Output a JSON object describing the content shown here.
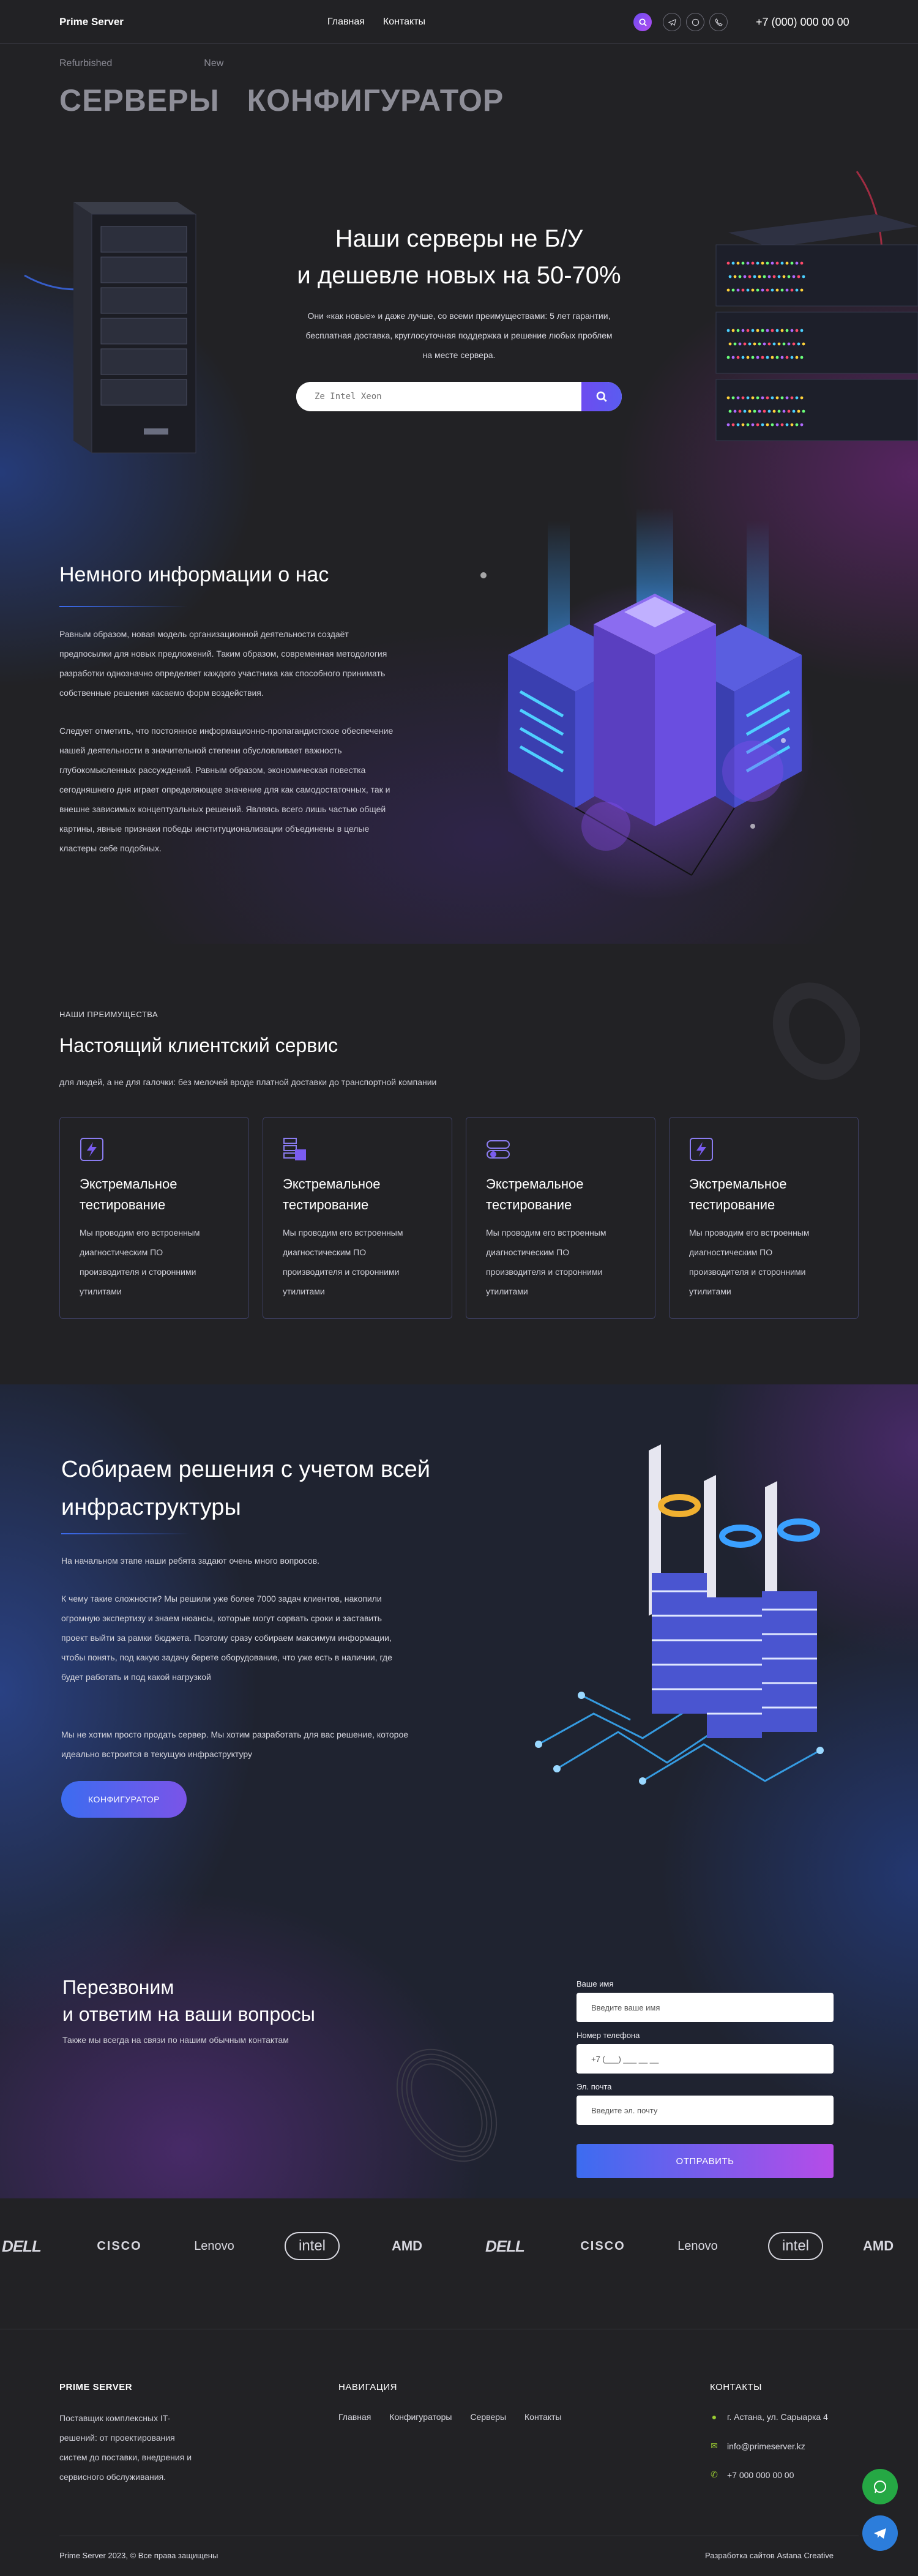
{
  "header": {
    "logo": "Prime Server",
    "nav": [
      "Главная",
      "Контакты"
    ],
    "phone": "+7 (000) 000 00 00"
  },
  "hero": {
    "tabs_small": [
      "Refurbished",
      "New"
    ],
    "tabs_big": [
      "СЕРВЕРЫ",
      "КОНФИГУРАТОР"
    ],
    "title_line1": "Наши серверы не Б/У",
    "title_line2": "и дешевле новых на 50-70%",
    "subtitle": "Они «как новые» и даже лучше, со всеми преимуществами: 5 лет гарантии, бесплатная доставка, круглосуточная поддержка и решение любых проблем на месте сервера.",
    "search_placeholder": "Ze Intel Xeon"
  },
  "about": {
    "title": "Немного информации о нас",
    "p1": "Равным образом, новая модель организационной деятельности создаёт предпосылки для новых предложений. Таким образом, современная методология разработки однозначно определяет каждого участника как способного принимать собственные решения касаемо форм воздействия.",
    "p2": "Следует отметить, что постоянное информационно-пропагандистское обеспечение нашей деятельности в значительной степени обусловливает важность глубокомысленных рассуждений. Равным образом, экономическая повестка сегодняшнего дня играет определяющее значение для как самодостаточных, так и внешне зависимых концептуальных решений. Являясь всего лишь частью общей картины, явные признаки победы институционализации объединены в целые кластеры себе подобных."
  },
  "advantages": {
    "label": "НАШИ ПРЕИМУЩЕСТВА",
    "title": "Настоящий клиентский сервис",
    "subtitle": "для людей, а не для галочки: без мелочей вроде платной доставки до транспортной компании",
    "cards": [
      {
        "title": "Экстремальное тестирование",
        "text": "Мы проводим его встроенным диагностическим ПО производителя и сторонними утилитами",
        "icon": "bolt-icon"
      },
      {
        "title": "Экстремальное тестирование",
        "text": "Мы проводим его встроенным диагностическим ПО производителя и сторонними утилитами",
        "icon": "server-icon"
      },
      {
        "title": "Экстремальное тестирование",
        "text": "Мы проводим его встроенным диагностическим ПО производителя и сторонними утилитами",
        "icon": "toggle-icon"
      },
      {
        "title": "Экстремальное тестирование",
        "text": "Мы проводим его встроенным диагностическим ПО производителя и сторонними утилитами",
        "icon": "bolt-icon"
      }
    ]
  },
  "infra": {
    "title": "Собираем решения с учетом всей инфраструктуры",
    "p1": "На начальном этапе наши ребята задают очень много вопросов.",
    "p2": "К чему такие сложности? Мы решили уже более 7000 задач клиентов, накопили огромную экспертизу и знаем нюансы, которые могут сорвать сроки и заставить проект выйти за рамки бюджета. Поэтому сразу собираем максимум информации, чтобы понять, под какую задачу берете оборудование, что уже есть в наличии, где будет работать и под какой нагрузкой",
    "p3": "Мы не хотим просто продать сервер. Мы хотим разработать для вас решение, которое идеально встроится в текущую инфраструктуру",
    "button": "КОНФИГУРАТОР"
  },
  "callback": {
    "title_line1": "Перезвоним",
    "title_line2": "и ответим на ваши вопросы",
    "subtitle": "Также мы всегда на связи по нашим обычным контактам",
    "fields": [
      {
        "label": "Ваше имя",
        "placeholder": "Введите ваше имя"
      },
      {
        "label": "Номер телефона",
        "placeholder": "+7 (___) ___ __ __"
      },
      {
        "label": "Эл. почта",
        "placeholder": "Введите эл. почту"
      }
    ],
    "submit": "ОТПРАВИТЬ"
  },
  "brands": [
    "DELL",
    "CISCO",
    "Lenovo",
    "intel",
    "AMD",
    "DELL",
    "CISCO",
    "Lenovo",
    "intel",
    "AMD"
  ],
  "footer": {
    "brand_head": "PRIME SERVER",
    "brand_desc": "Поставщик комплексных IT-решений: от проектирования систем до поставки, внедрения и сервисного обслуживания.",
    "nav_head": "НАВИГАЦИЯ",
    "nav": [
      "Главная",
      "Конфигураторы",
      "Серверы",
      "Контакты"
    ],
    "contacts_head": "КОНТАКТЫ",
    "address": "г. Астана, ул. Сарыарка 4",
    "email": "info@primeserver.kz",
    "phone": "+7 000 000 00 00",
    "copyright": "Prime Server 2023, © Все права защищены",
    "developer": "Разработка сайтов Astana Creative"
  },
  "colors": {
    "accent": "#6d4cf0",
    "blue": "#3c6cf0",
    "bg": "#222225",
    "whatsapp": "#25a844",
    "telegram": "#2c7ddb"
  }
}
